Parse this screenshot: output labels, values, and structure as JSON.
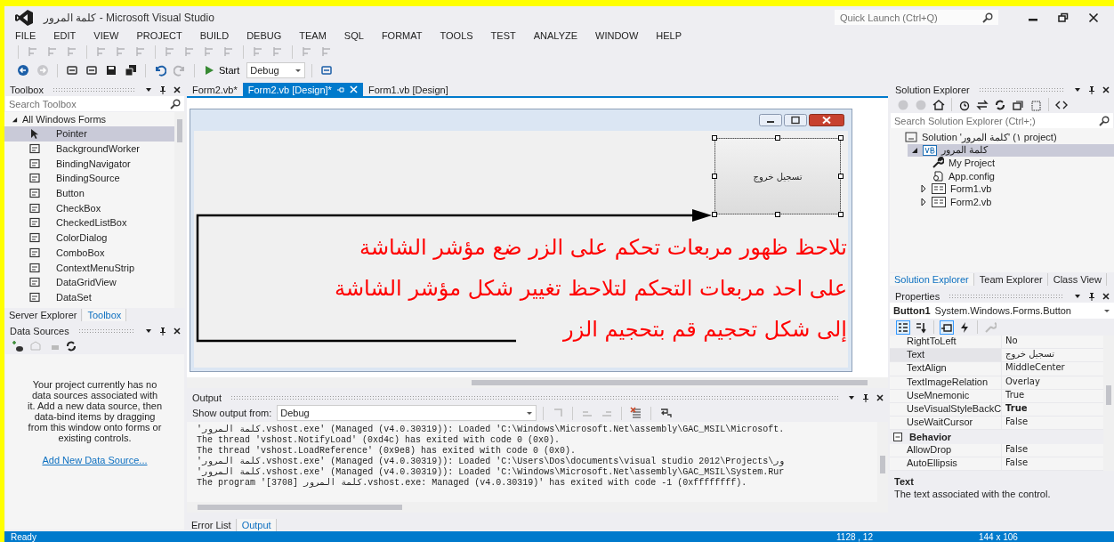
{
  "window": {
    "title": "كلمة المرور - Microsoft Visual Studio",
    "quick_launch_placeholder": "Quick Launch (Ctrl+Q)"
  },
  "menu": [
    "FILE",
    "EDIT",
    "VIEW",
    "PROJECT",
    "BUILD",
    "DEBUG",
    "TEAM",
    "SQL",
    "FORMAT",
    "TOOLS",
    "TEST",
    "ANALYZE",
    "WINDOW",
    "HELP"
  ],
  "toolbar": {
    "start_label": "Start",
    "configuration": "Debug"
  },
  "toolbox": {
    "title": "Toolbox",
    "search_placeholder": "Search Toolbox",
    "group": "All Windows Forms",
    "group_expanded": true,
    "items": [
      {
        "label": "Pointer",
        "selected": true
      },
      {
        "label": "BackgroundWorker",
        "selected": false
      },
      {
        "label": "BindingNavigator",
        "selected": false
      },
      {
        "label": "BindingSource",
        "selected": false
      },
      {
        "label": "Button",
        "selected": false
      },
      {
        "label": "CheckBox",
        "selected": false
      },
      {
        "label": "CheckedListBox",
        "selected": false
      },
      {
        "label": "ColorDialog",
        "selected": false
      },
      {
        "label": "ComboBox",
        "selected": false
      },
      {
        "label": "ContextMenuStrip",
        "selected": false
      },
      {
        "label": "DataGridView",
        "selected": false
      },
      {
        "label": "DataSet",
        "selected": false
      }
    ],
    "tabs": [
      {
        "label": "Server Explorer",
        "selected": false
      },
      {
        "label": "Toolbox",
        "selected": true
      }
    ]
  },
  "data_sources": {
    "title": "Data Sources",
    "message": "Your project currently has no data sources associated with it. Add a new data source, then data-bind items by dragging from this window onto forms or existing controls.",
    "link": "Add New Data Source..."
  },
  "document_tabs": [
    {
      "label": "Form2.vb*",
      "selected": false
    },
    {
      "label": "Form2.vb [Design]*",
      "selected": true
    },
    {
      "label": "Form1.vb [Design]",
      "selected": false
    }
  ],
  "designer": {
    "button_text": "تسجيل خروج",
    "button_selected": true
  },
  "annotation": [
    "تلاحظ ظهور مربعات تحكم على الزر ضع مؤشر الشاشة",
    "على احد مربعات التحكم لتلاحظ تغيير شكل مؤشر الشاشة",
    "إلى شكل تحجيم قم بتحجيم الزر"
  ],
  "output": {
    "title": "Output",
    "show_from_label": "Show output from:",
    "source": "Debug",
    "lines": [
      "'كلمة المرور.vshost.exe' (Managed (v4.0.30319)): Loaded 'C:\\Windows\\Microsoft.Net\\assembly\\GAC_MSIL\\Microsoft.",
      "The thread 'vshost.NotifyLoad' (0xd4c) has exited with code 0 (0x0).",
      "The thread 'vshost.LoadReference' (0x9e8) has exited with code 0 (0x0).",
      "'كلمة المرور.vshost.exe' (Managed (v4.0.30319)): Loaded 'C:\\Users\\Dos\\documents\\visual studio 2012\\Projects\\ور",
      "'كلمة المرور.vshost.exe' (Managed (v4.0.30319)): Loaded 'C:\\Windows\\Microsoft.Net\\assembly\\GAC_MSIL\\System.Rur",
      "The program '[3708] كلمة المرور.vshost.exe: Managed (v4.0.30319)' has exited with code -1 (0xffffffff)."
    ],
    "tabs": [
      {
        "label": "Error List",
        "selected": false
      },
      {
        "label": "Output",
        "selected": true
      }
    ]
  },
  "solution_explorer": {
    "title": "Solution Explorer",
    "search_placeholder": "Search Solution Explorer (Ctrl+;)",
    "tree": [
      {
        "label": "Solution 'كلمة المرور' (١ project)",
        "kind": "solution",
        "selected": false,
        "children": [
          {
            "label": "كلمة المرور",
            "kind": "project",
            "selected": true,
            "expanded": true,
            "children": [
              {
                "label": "My Project",
                "kind": "settings",
                "selected": false
              },
              {
                "label": "App.config",
                "kind": "config",
                "selected": false
              },
              {
                "label": "Form1.vb",
                "kind": "form",
                "selected": false,
                "expanded": false
              },
              {
                "label": "Form2.vb",
                "kind": "form",
                "selected": false,
                "expanded": false
              }
            ]
          }
        ]
      }
    ],
    "tabs": [
      {
        "label": "Solution Explorer",
        "selected": true
      },
      {
        "label": "Team Explorer",
        "selected": false
      },
      {
        "label": "Class View",
        "selected": false
      }
    ]
  },
  "properties": {
    "title": "Properties",
    "object_name": "Button1",
    "object_type": "System.Windows.Forms.Button",
    "rows": [
      {
        "kind": "property",
        "name": "RightToLeft",
        "value": "No",
        "bold": false,
        "selected": false
      },
      {
        "kind": "property",
        "name": "Text",
        "value": "تسجيل خروج",
        "bold": false,
        "selected": true
      },
      {
        "kind": "property",
        "name": "TextAlign",
        "value": "MiddleCenter",
        "bold": false,
        "selected": false
      },
      {
        "kind": "property",
        "name": "TextImageRelation",
        "value": "Overlay",
        "bold": false,
        "selected": false
      },
      {
        "kind": "property",
        "name": "UseMnemonic",
        "value": "True",
        "bold": false,
        "selected": false
      },
      {
        "kind": "property",
        "name": "UseVisualStyleBackC",
        "value": "True",
        "bold": true,
        "selected": false
      },
      {
        "kind": "property",
        "name": "UseWaitCursor",
        "value": "False",
        "bold": false,
        "selected": false
      },
      {
        "kind": "category",
        "name": "Behavior",
        "expanded": true
      },
      {
        "kind": "property",
        "name": "AllowDrop",
        "value": "False",
        "bold": false,
        "selected": false
      },
      {
        "kind": "property",
        "name": "AutoEllipsis",
        "value": "False",
        "bold": false,
        "selected": false
      }
    ],
    "description_title": "Text",
    "description": "The text associated with the control."
  },
  "status_bar": {
    "message": "Ready",
    "position": "1128 , 12",
    "size": "144 x 106"
  }
}
